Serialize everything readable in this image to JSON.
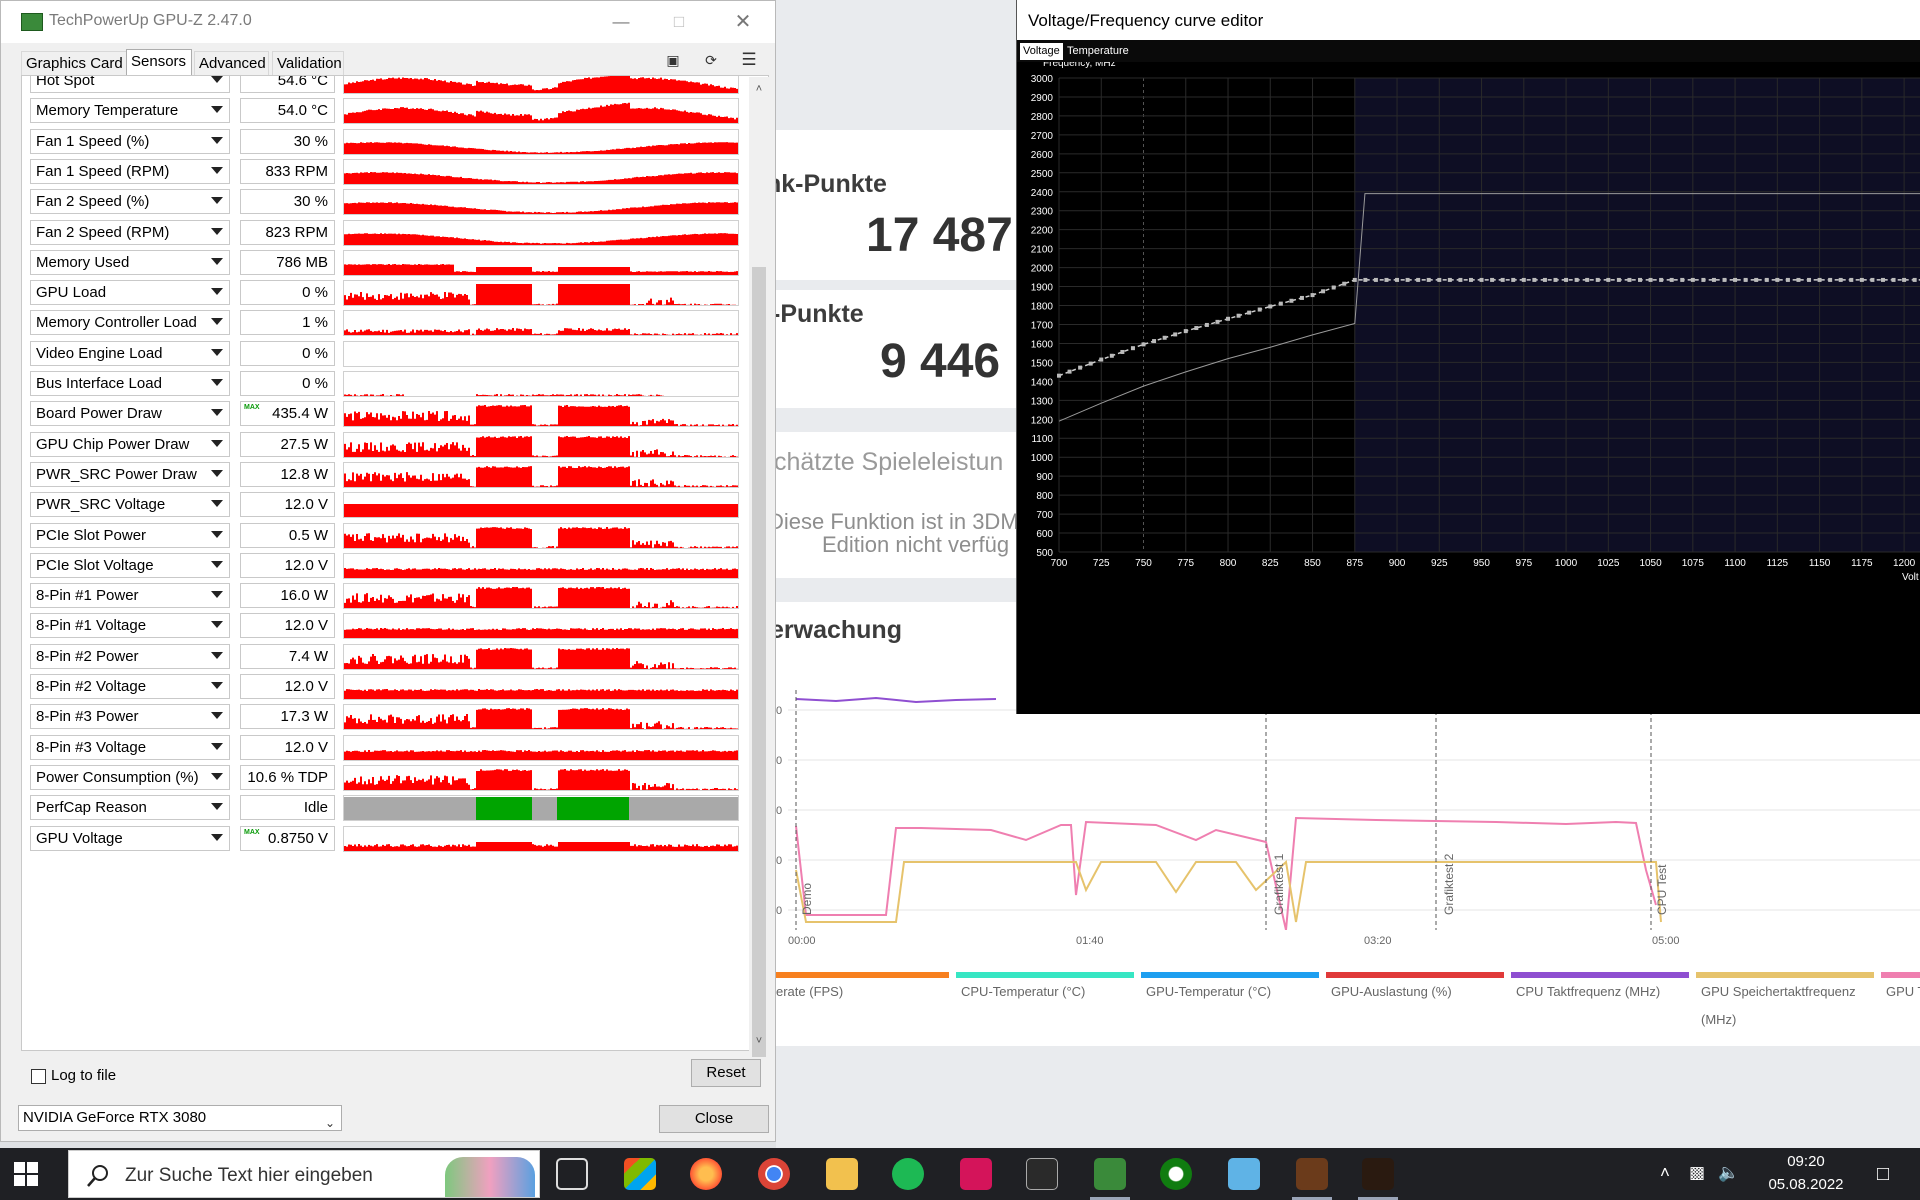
{
  "gpuz": {
    "title": "TechPowerUp GPU-Z 2.47.0",
    "tabs": [
      "Graphics Card",
      "Sensors",
      "Advanced",
      "Validation"
    ],
    "active_tab": "Sensors",
    "max_marker": "MAX",
    "sensors": [
      {
        "name": "Hot Spot",
        "value": "54.6 °C",
        "graph": "temp"
      },
      {
        "name": "Memory Temperature",
        "value": "54.0 °C",
        "graph": "temp"
      },
      {
        "name": "Fan 1 Speed (%)",
        "value": "30 %",
        "graph": "fan"
      },
      {
        "name": "Fan 1 Speed (RPM)",
        "value": "833 RPM",
        "graph": "fan"
      },
      {
        "name": "Fan 2 Speed (%)",
        "value": "30 %",
        "graph": "fan"
      },
      {
        "name": "Fan 2 Speed (RPM)",
        "value": "823 RPM",
        "graph": "fan"
      },
      {
        "name": "Memory Used",
        "value": "786 MB",
        "graph": "mem"
      },
      {
        "name": "GPU Load",
        "value": "0 %",
        "graph": "load"
      },
      {
        "name": "Memory Controller Load",
        "value": "1 %",
        "graph": "mcl"
      },
      {
        "name": "Video Engine Load",
        "value": "0 %",
        "graph": "none"
      },
      {
        "name": "Bus Interface Load",
        "value": "0 %",
        "graph": "bus"
      },
      {
        "name": "Board Power Draw",
        "value": "435.4 W",
        "graph": "power",
        "max": true
      },
      {
        "name": "GPU Chip Power Draw",
        "value": "27.5 W",
        "graph": "power"
      },
      {
        "name": "PWR_SRC Power Draw",
        "value": "12.8 W",
        "graph": "power"
      },
      {
        "name": "PWR_SRC Voltage",
        "value": "12.0 V",
        "graph": "volt"
      },
      {
        "name": "PCIe Slot Power",
        "value": "0.5 W",
        "graph": "power"
      },
      {
        "name": "PCIe Slot Voltage",
        "value": "12.0 V",
        "graph": "volt2"
      },
      {
        "name": "8-Pin #1 Power",
        "value": "16.0 W",
        "graph": "power"
      },
      {
        "name": "8-Pin #1 Voltage",
        "value": "12.0 V",
        "graph": "volt2"
      },
      {
        "name": "8-Pin #2 Power",
        "value": "7.4 W",
        "graph": "power"
      },
      {
        "name": "8-Pin #2 Voltage",
        "value": "12.0 V",
        "graph": "volt2"
      },
      {
        "name": "8-Pin #3 Power",
        "value": "17.3 W",
        "graph": "power"
      },
      {
        "name": "8-Pin #3 Voltage",
        "value": "12.0 V",
        "graph": "volt2"
      },
      {
        "name": "Power Consumption (%)",
        "value": "10.6 % TDP",
        "graph": "power"
      },
      {
        "name": "PerfCap Reason",
        "value": "Idle",
        "graph": "perfcap"
      },
      {
        "name": "GPU Voltage",
        "value": "0.8750 V",
        "graph": "gpuvolt",
        "max": true
      }
    ],
    "log_to_file": "Log to file",
    "reset": "Reset",
    "gpu_name": "NVIDIA GeForce RTX 3080",
    "close": "Close",
    "colors": {
      "graph": "#ff0000",
      "perfcap_idle": "#a9a9a9",
      "perfcap_active": "#00a400"
    }
  },
  "threedmark": {
    "graphics_label": "nk-Punkte",
    "graphics_score": "17 487",
    "cpu_label": "-Punkte",
    "cpu_score": "9 446",
    "estimate_label": "chätzte Spieleleistun",
    "estimate_info_1": "Diese Funktion ist in 3DM",
    "estimate_info_2": "Edition nicht verfüg",
    "monitoring_label": "erwachung",
    "y_ticks": [
      "0",
      "0",
      "0",
      "0",
      "0"
    ],
    "time_ticks": [
      "00:00",
      "01:40",
      "03:20",
      "05:00"
    ],
    "events": [
      "Demo",
      "Grafiktest 1",
      "Grafiktest 2",
      "CPU Test"
    ],
    "legend": [
      {
        "label": "erate (FPS)",
        "color": "#f7801f"
      },
      {
        "label": "CPU-Temperatur (°C)",
        "color": "#37e6c3"
      },
      {
        "label": "GPU-Temperatur (°C)",
        "color": "#1e9ff0"
      },
      {
        "label": "GPU-Auslastung (%)",
        "color": "#e03a3a"
      },
      {
        "label": "CPU Taktfrequenz (MHz)",
        "color": "#8f4fd1"
      },
      {
        "label": "GPU Speichertaktfrequenz (MHz)",
        "color": "#e6c36c"
      },
      {
        "label": "GPU Taktf",
        "color": "#ef7fb0"
      }
    ]
  },
  "vf_editor": {
    "title": "Voltage/Frequency curve editor",
    "tabs": [
      "Voltage",
      "Temperature"
    ],
    "y_axis_label": "Frequency, MHz",
    "x_axis_label": "Volt",
    "chart_data": {
      "type": "line",
      "title": "",
      "ylabel": "Frequency, MHz",
      "xlabel": "Volt",
      "xlim": [
        700,
        1210
      ],
      "ylim": [
        500,
        3000
      ],
      "x_ticks": [
        700,
        725,
        750,
        775,
        800,
        825,
        850,
        875,
        900,
        925,
        950,
        975,
        1000,
        1025,
        1050,
        1075,
        1100,
        1125,
        1150,
        1175,
        1200
      ],
      "y_ticks": [
        500,
        600,
        700,
        800,
        900,
        1000,
        1100,
        1200,
        1300,
        1400,
        1500,
        1600,
        1700,
        1800,
        1900,
        2000,
        2100,
        2200,
        2300,
        2400,
        2500,
        2600,
        2700,
        2800,
        2900,
        3000
      ],
      "highlight_from_x": 875,
      "series": [
        {
          "values": [
            [
              700,
              1190
            ],
            [
              725,
              1285
            ],
            [
              750,
              1375
            ],
            [
              775,
              1450
            ],
            [
              800,
              1520
            ],
            [
              825,
              1580
            ],
            [
              850,
              1645
            ],
            [
              875,
              1705
            ],
            [
              881,
              2390
            ],
            [
              1210,
              2390
            ]
          ]
        },
        {
          "values": [
            [
              700,
              1430
            ],
            [
              725,
              1515
            ],
            [
              750,
              1595
            ],
            [
              775,
              1665
            ],
            [
              800,
              1730
            ],
            [
              825,
              1795
            ],
            [
              850,
              1855
            ],
            [
              875,
              1935
            ],
            [
              1210,
              1935
            ]
          ]
        }
      ]
    }
  },
  "taskbar": {
    "search_placeholder": "Zur Suche Text hier eingeben",
    "time": "09:20",
    "date": "05.08.2022"
  }
}
